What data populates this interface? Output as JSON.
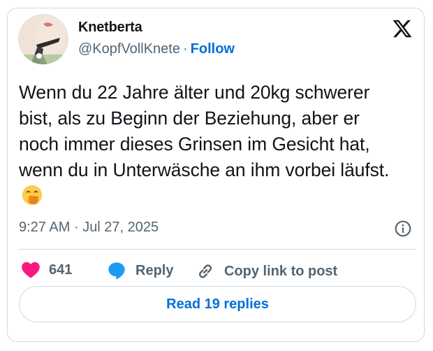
{
  "author": {
    "display_name": "Knetberta",
    "handle": "@KopfVollKnete",
    "separator": "·",
    "follow_label": "Follow"
  },
  "tweet": {
    "text": "Wenn du 22 Jahre älter und 20kg schwerer bist, als zu Beginn der Beziehung, aber er noch immer dieses Grinsen im Gesicht hat, wenn du in Unterwäsche an ihm vorbei läufst.",
    "emoji": "face-with-hand-over-mouth",
    "time": "9:27 AM",
    "date_separator": "·",
    "date": "Jul 27, 2025"
  },
  "actions": {
    "like_count": "641",
    "reply_label": "Reply",
    "copy_link_label": "Copy link to post"
  },
  "footer": {
    "read_replies_label": "Read 19 replies"
  },
  "icons": {
    "logo": "x-logo-icon",
    "info": "info-icon",
    "like": "heart-icon",
    "reply": "speech-bubble-icon",
    "copy": "link-icon"
  },
  "colors": {
    "accent": "#006fd6",
    "like": "#f91880",
    "reply": "#1d9bf0",
    "secondary_text": "#536471",
    "border": "#cfd9de"
  }
}
